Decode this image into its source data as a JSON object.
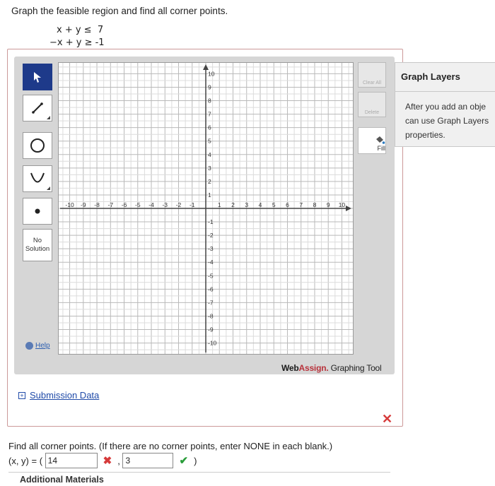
{
  "question": {
    "prompt": "Graph the feasible region and find all corner points.",
    "ineq1": "x + y ≤  7",
    "ineq2": "−x + y ≥ -1"
  },
  "tools": {
    "no_solution_line1": "No",
    "no_solution_line2": "Solution",
    "help": "Help"
  },
  "right_tools": {
    "clear_all": "Clear All",
    "delete": "Delete",
    "fill": "Fill"
  },
  "graph": {
    "x_min": -10,
    "x_max": 10,
    "y_min": -10,
    "y_max": 10,
    "x_ticks": [
      "-10",
      "-9",
      "-8",
      "-7",
      "-6",
      "-5",
      "-4",
      "-3",
      "-2",
      "-1",
      "1",
      "2",
      "3",
      "4",
      "5",
      "6",
      "7",
      "8",
      "9",
      "10"
    ],
    "y_ticks": [
      "10",
      "9",
      "8",
      "7",
      "6",
      "5",
      "4",
      "3",
      "2",
      "1",
      "-1",
      "-2",
      "-3",
      "-4",
      "-5",
      "-6",
      "-7",
      "-8",
      "-9",
      "-10"
    ]
  },
  "brand": {
    "web": "Web",
    "assign": "Assign.",
    "rest": " Graphing Tool"
  },
  "submission": {
    "label": "Submission Data"
  },
  "layers": {
    "title": "Graph Layers",
    "line1": "After you add an obje",
    "line2": "can use Graph Layers",
    "line3": "properties."
  },
  "answer": {
    "question": "Find all corner points. (If there are no corner points, enter NONE in each blank.)",
    "prefix": "(x, y) = (",
    "x_value": "14",
    "y_value": "3",
    "separator": ",",
    "suffix": ")"
  },
  "additional": "Additional Materials"
}
